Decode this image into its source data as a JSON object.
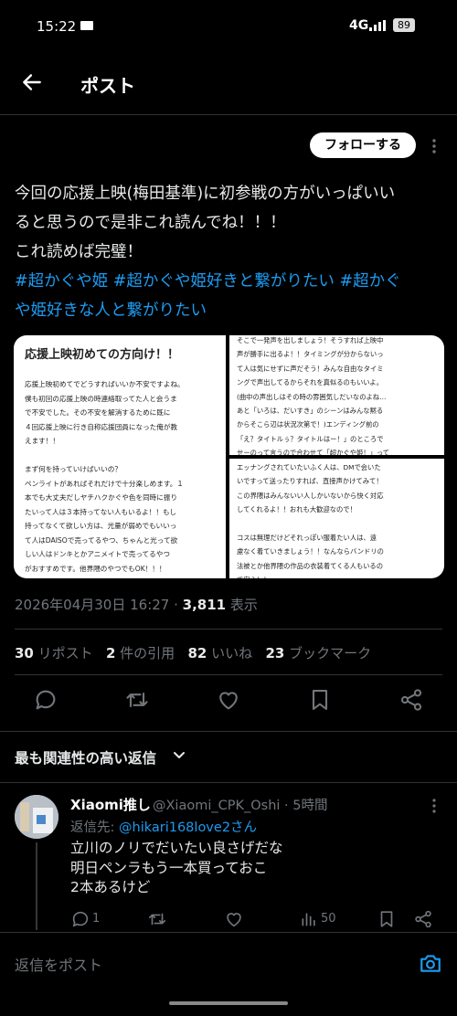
{
  "status_bar": {
    "time": "15:22",
    "network": "4G",
    "battery": "89"
  },
  "header": {
    "title": "ポスト"
  },
  "post": {
    "follow_label": "フォローする",
    "text_lines": [
      "今回の応援上映(梅田基準)に初参戦の方がいっぱいい",
      "ると思うので是非これ読んでね！！！",
      "これ読めば完璧！"
    ],
    "hashtag_lines": [
      "#超かぐや姫 #超かぐや姫好きと繋がりたい #超かぐ",
      "や姫好きな人と繋がりたい"
    ],
    "image_left": {
      "title": "応援上映初めての方向け！！",
      "body": "応援上映初めてでどうすればいいか不安ですよね。\n僕も初回の応援上映の時連絡取ってた人と会うま\nで不安でした。その不安を解消するために既に\n４回応援上映に行き自称応援団員になった俺が教\nえます！！\n\nまず何を持っていけばいいの？\nペンライトがあればそれだけで十分楽しめます。１\n本でも大丈夫だしヤチハクかぐや色を同時に振り\nたいって人は３本持ってない人もいるよ！！もし\n持ってなくて欲しい方は、光量が弱めでもいいっ\nて人はDAISOで売ってるやつ、ちゃんと光って欲\nしい人はドンキとかアニメイトで売ってるやつ\nがおすすめです。他界隈のやつでもOK！！！"
    },
    "image_right_top": {
      "body": "そこで一発声を出しましょう！そうすれば上映中\n声が勝手に出るよ！！タイミングが分からないっ\nて人は気にせずに声だそう！みんな自由なタイミ\nングで声出してるからそれを真似るのもいいよ。\n(曲中の声出しはその時の雰囲気しだいなのよね…\nあと「いろは、だいすき」のシーンはみんな黙る\nからそこら辺は状況次第で！)エンディング前の\n「え？タイトルぅ？タイトルはー！」のところで\nせーのって言うので合わせて「超かぐや姫！」って"
    },
    "image_right_bottom": {
      "body": "エッナングされていたいふく人は、DMで会いた\nいですって送ったりすれば、直接声かけてみて！\nこの界隈はみんないい人しかいないから快く対応\nしてくれるよ！！おれも大歓迎なので！\n\nコスは無理だけどそれっぽい服着たい人は、遠\n慮なく着ていきましょう！！なんならバンドリの\n法被とか他界隈の作品の衣装着てくる人もいるの\nで安心！！"
    },
    "timestamp": "2026年04月30日 16:27 · ",
    "views_count": "3,811",
    "views_label": " 表示",
    "stats": {
      "reposts_count": "30",
      "reposts_label": " リポスト",
      "quotes_count": "2",
      "quotes_label": " 件の引用",
      "likes_count": "82",
      "likes_label": " いいね",
      "bookmarks_count": "23",
      "bookmarks_label": " ブックマーク"
    }
  },
  "replies_header": "最も関連性の高い返信",
  "reply": {
    "name": "Xiaomi推し",
    "handle": "@Xiaomi_CPK_Oshi · 5時間",
    "reply_to_prefix": "返信先: ",
    "reply_to_user": "@hikari168love2さん",
    "lines": [
      "立川のノリでだいたい良さげだな",
      "明日ペンラもう一本買っておこ",
      "2本あるけど"
    ],
    "reply_count": "1",
    "view_count": "50"
  },
  "compose": {
    "placeholder": "返信をポスト"
  },
  "colors": {
    "accent": "#1d9bf0",
    "background": "#000000",
    "muted": "#71767b"
  },
  "icons": [
    "back-arrow-icon",
    "more-vert-icon",
    "reply-icon",
    "repost-icon",
    "like-icon",
    "bookmark-icon",
    "share-icon",
    "chevron-down-icon",
    "views-icon",
    "camera-icon"
  ]
}
